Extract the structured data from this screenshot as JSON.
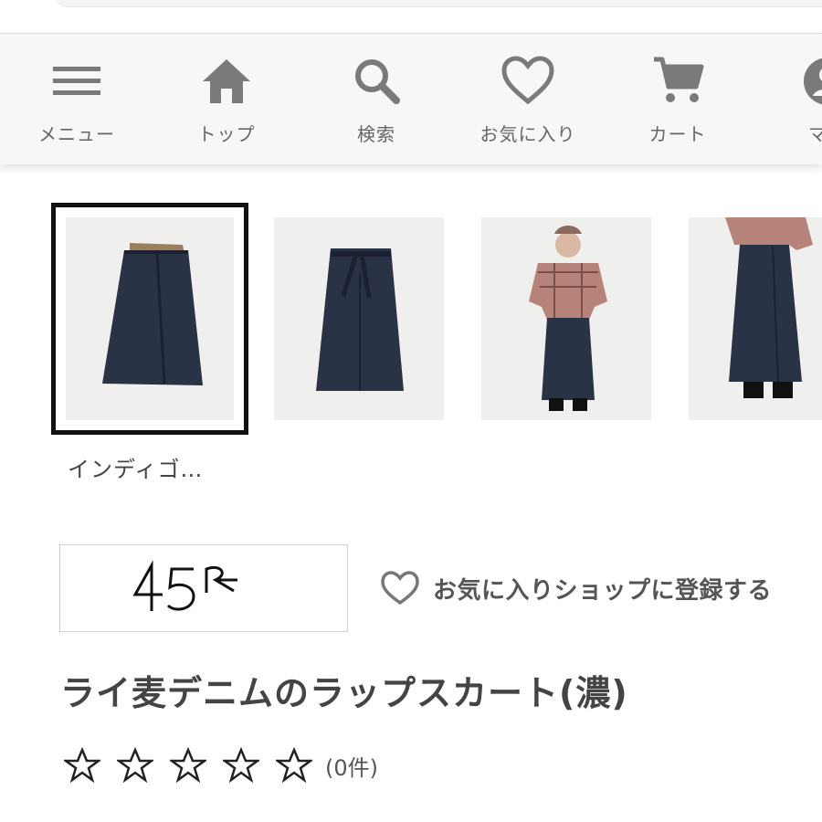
{
  "nav": {
    "items": [
      {
        "label": "メニュー",
        "icon": "menu-icon"
      },
      {
        "label": "トップ",
        "icon": "home-icon"
      },
      {
        "label": "検索",
        "icon": "search-icon"
      },
      {
        "label": "お気に入り",
        "icon": "heart-icon"
      },
      {
        "label": "カート",
        "icon": "cart-icon"
      },
      {
        "label": "マイ",
        "icon": "user-icon"
      }
    ]
  },
  "product": {
    "variant_label": "インディゴ…",
    "shop_logo_text": "45R",
    "favorite_shop_label": "お気に入りショップに登録する",
    "title": "ライ麦デニムのラップスカート(濃)",
    "rating": {
      "stars": 0,
      "max": 5,
      "count_label": "(0件)"
    }
  },
  "colors": {
    "icon_gray": "#7a7a7a",
    "denim": "#2a3246",
    "thumb_bg": "#efefed"
  }
}
